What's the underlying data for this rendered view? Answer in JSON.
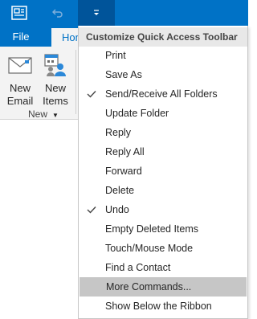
{
  "colors": {
    "accent": "#0072c6",
    "dropdown_active": "#00549a",
    "ribbon_bg": "#f3f3f3",
    "menu_header_bg": "#e8e8e8",
    "menu_highlight": "#c6c6c6"
  },
  "titlebar": {
    "icons": [
      "outlook-app-icon",
      "undo-icon",
      "qat-dropdown-arrow-icon"
    ]
  },
  "tabs": {
    "file": "File",
    "home": "Hom"
  },
  "ribbon": {
    "new_email": {
      "line1": "New",
      "line2": "Email",
      "icon": "email-icon"
    },
    "new_items": {
      "line1": "New",
      "line2": "Items",
      "icon": "new-items-icon"
    },
    "group_label": "New"
  },
  "menu": {
    "title": "Customize Quick Access Toolbar",
    "items": [
      {
        "label": "Print",
        "checked": false
      },
      {
        "label": "Save As",
        "checked": false
      },
      {
        "label": "Send/Receive All Folders",
        "checked": true
      },
      {
        "label": "Update Folder",
        "checked": false
      },
      {
        "label": "Reply",
        "checked": false
      },
      {
        "label": "Reply All",
        "checked": false
      },
      {
        "label": "Forward",
        "checked": false
      },
      {
        "label": "Delete",
        "checked": false
      },
      {
        "label": "Undo",
        "checked": true
      },
      {
        "label": "Empty Deleted Items",
        "checked": false
      },
      {
        "label": "Touch/Mouse Mode",
        "checked": false
      },
      {
        "label": "Find a Contact",
        "checked": false
      },
      {
        "label": "More Commands...",
        "checked": false,
        "highlighted": true
      },
      {
        "label": "Show Below the Ribbon",
        "checked": false
      }
    ]
  }
}
